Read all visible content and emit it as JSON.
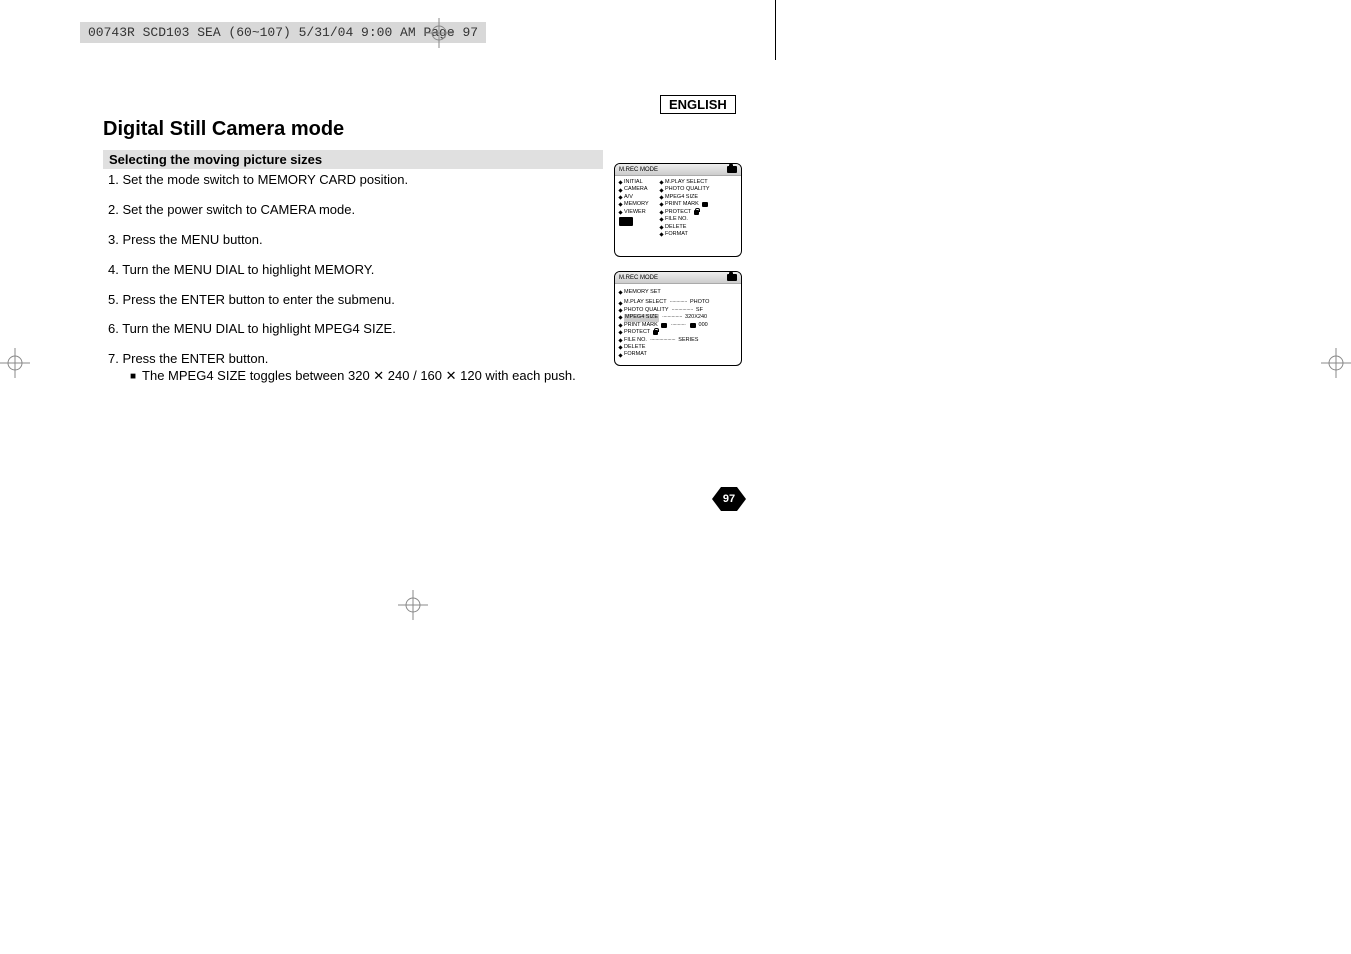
{
  "meta": {
    "header_text": "00743R SCD103 SEA (60~107)  5/31/04 9:00 AM  Page 97",
    "page_number": "97"
  },
  "labels": {
    "english": "ENGLISH"
  },
  "title": "Digital Still Camera mode",
  "section": "Selecting the moving picture sizes",
  "steps": {
    "s1": "1.  Set the mode switch to MEMORY CARD position.",
    "s2": "2.  Set the power switch to CAMERA mode.",
    "s3": "3.  Press the MENU button.",
    "s4": "4.  Turn the MENU DIAL to highlight MEMORY.",
    "s5": "5.  Press the ENTER button to enter the submenu.",
    "s6": "6.  Turn the MENU DIAL to highlight MPEG4 SIZE.",
    "s7": "7.  Press the ENTER button.",
    "s7_sub": "The MPEG4 SIZE toggles between 320 ✕ 240 / 160 ✕ 120 with each push."
  },
  "screen1": {
    "header": "M.REC  MODE",
    "left": {
      "i1": "INITIAL",
      "i2": "CAMERA",
      "i3": "A/V",
      "i4": "MEMORY",
      "i5": "VIEWER"
    },
    "right": {
      "r1": "M.PLAY SELECT",
      "r2": "PHOTO QUALITY",
      "r3": "MPEG4 SIZE",
      "r4": "PRINT MARK",
      "r5": "PROTECT",
      "r6": "FILE NO.",
      "r7": "DELETE",
      "r8": "FORMAT"
    }
  },
  "screen2": {
    "header": "M.REC  MODE",
    "subheader": "MEMORY SET",
    "rows": {
      "r1_l": "M.PLAY SELECT",
      "r1_r": "PHOTO",
      "r2_l": "PHOTO QUALITY",
      "r2_r": "SF",
      "r3_l": "MPEG4 SIZE",
      "r3_r": "320X240",
      "r4_l": "PRINT MARK",
      "r4_r": "000",
      "r5_l": "PROTECT",
      "r6_l": "FILE NO.",
      "r6_r": "SERIES",
      "r7_l": "DELETE",
      "r8_l": "FORMAT"
    }
  }
}
